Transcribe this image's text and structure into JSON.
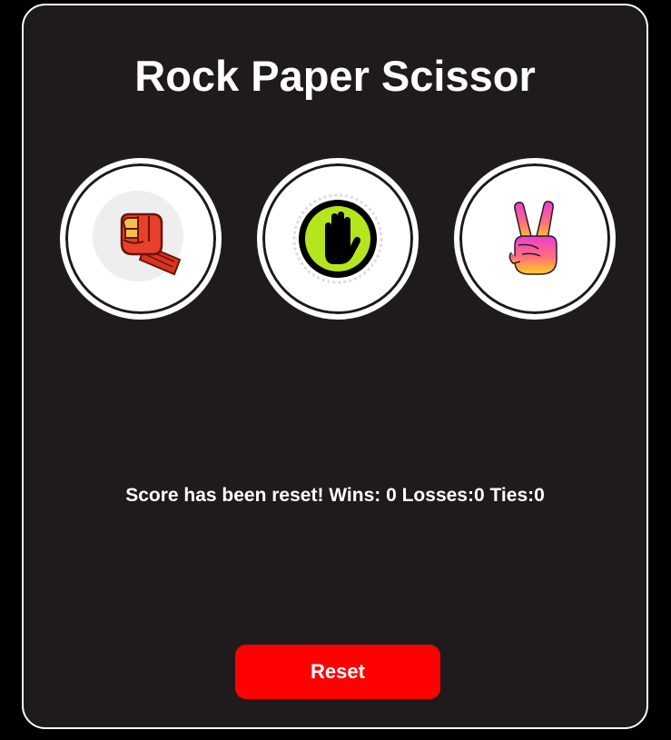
{
  "title": "Rock Paper Scissor",
  "choices": [
    {
      "name": "rock",
      "icon": "raised-fist-icon"
    },
    {
      "name": "paper",
      "icon": "raised-hand-icon"
    },
    {
      "name": "scissors",
      "icon": "victory-hand-icon"
    }
  ],
  "result_text": "Score has been reset! Wins: 0 Losses:0 Ties:0",
  "reset_label": "Reset",
  "colors": {
    "background": "#000000",
    "card": "#1f1a1b",
    "border": "#ffffff",
    "reset_button": "#ff0000",
    "paper_green": "#b5e61d"
  }
}
